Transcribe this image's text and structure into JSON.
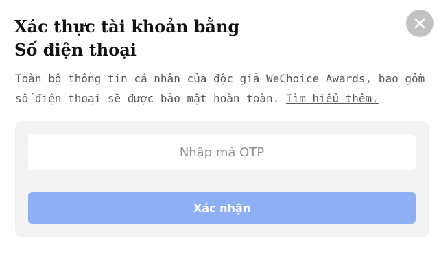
{
  "dialog": {
    "title_line1": "Xác thực tài khoản bằng",
    "title_line2": "Số điện thoại",
    "close_icon": "close-icon",
    "description": "Toàn bộ thông tin cá nhân của độc giả WeChoice Awards, bao gồm số điện thoại sẽ được bảo mật hoàn toàn.",
    "learn_more_link": "Tìm hiểu thêm.",
    "otp_input": {
      "value": "",
      "placeholder": "Nhập mã OTP"
    },
    "confirm_label": "Xác nhận",
    "colors": {
      "button_bg": "#8eaff3",
      "panel_bg": "#f3f3f3",
      "close_bg": "#c2c2c2"
    }
  }
}
